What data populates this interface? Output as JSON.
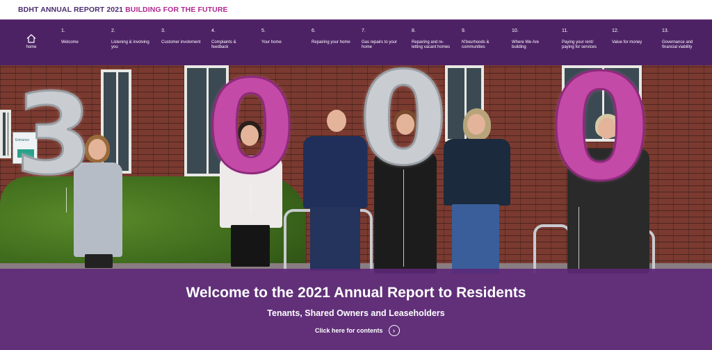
{
  "header": {
    "report_title": "BDHT ANNUAL REPORT 2021",
    "tagline": "BUILDING FOR THE FUTURE",
    "colors": {
      "brand_purple": "#4a2c6e",
      "accent_pink": "#b0278f",
      "nav_bg": "#4d2265"
    }
  },
  "nav": {
    "home": {
      "label": "home",
      "icon": "home-icon"
    },
    "items": [
      {
        "num": "1.",
        "label": "Welcome"
      },
      {
        "num": "2.",
        "label": "Listening & involving you"
      },
      {
        "num": "3.",
        "label": "Customer involvment"
      },
      {
        "num": "4.",
        "label": "Complaints & feedback"
      },
      {
        "num": "5.",
        "label": "Your home"
      },
      {
        "num": "6.",
        "label": "Repairing your home"
      },
      {
        "num": "7.",
        "label": "Gas repairs to your home"
      },
      {
        "num": "8.",
        "label": "Repairing and re-letting vacant homes"
      },
      {
        "num": "9.",
        "label": "N'bourhoods & communities"
      },
      {
        "num": "10.",
        "label": "Where We Are building"
      },
      {
        "num": "11.",
        "label": "Paying your rent/ paying for services"
      },
      {
        "num": "12.",
        "label": "Value for money"
      },
      {
        "num": "13.",
        "label": "Governance and financial viability"
      }
    ]
  },
  "hero": {
    "balloon_digits": [
      "3",
      "0",
      "0",
      "0"
    ],
    "entrance_sign": "Entrance",
    "title": "Welcome to the 2021 Annual Report to Residents",
    "subtitle": "Tenants, Shared Owners and Leaseholders",
    "cta_label": "Click here for contents",
    "cta_icon": "chevron-right-circle-icon"
  }
}
